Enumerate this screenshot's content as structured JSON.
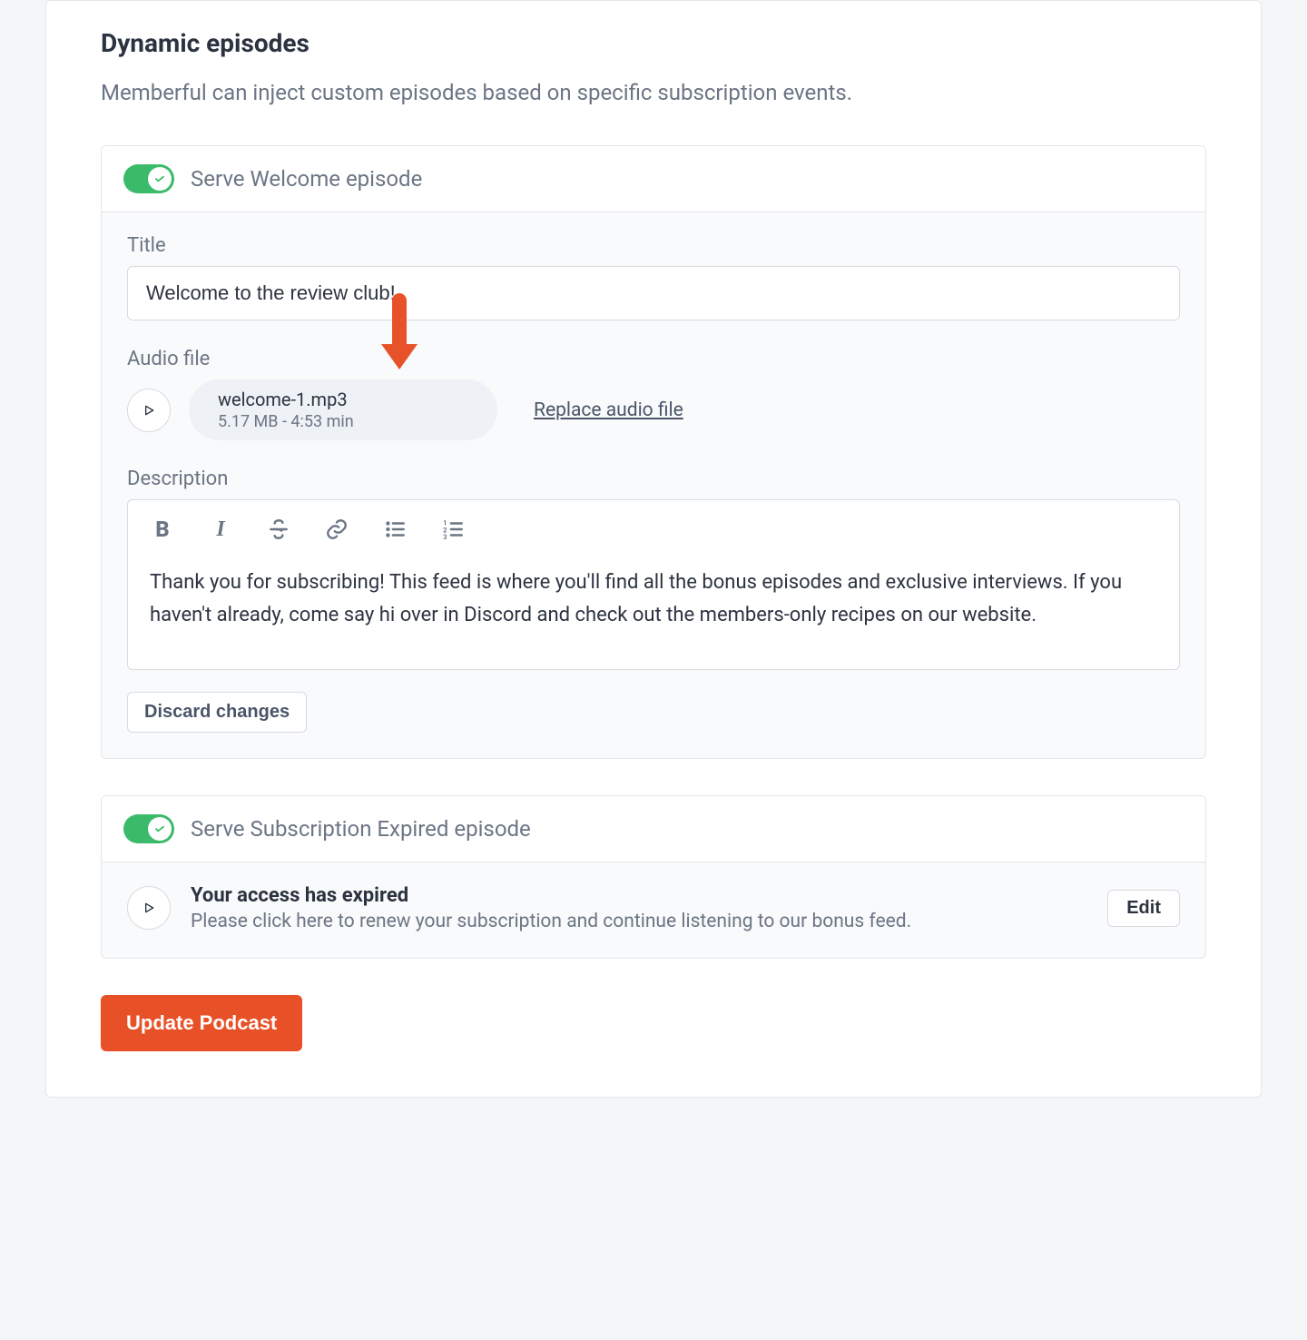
{
  "section": {
    "title": "Dynamic episodes",
    "subtitle": "Memberful can inject custom episodes based on specific subscription events."
  },
  "welcome_panel": {
    "toggle_label": "Serve Welcome episode",
    "title_label": "Title",
    "title_value": "Welcome to the review club!",
    "audio_label": "Audio file",
    "audio_filename": "welcome-1.mp3",
    "audio_meta": "5.17 MB - 4:53 min",
    "replace_label": "Replace audio file",
    "description_label": "Description",
    "description_text": "Thank you for subscribing! This feed is where you'll find all the bonus episodes and exclusive interviews. If you haven't already, come say hi over in Discord and check out the members-only recipes on our website.",
    "discard_label": "Discard changes"
  },
  "expired_panel": {
    "toggle_label": "Serve Subscription Expired episode",
    "title": "Your access has expired",
    "description": "Please click here to renew your subscription and continue listening to our bonus feed.",
    "edit_label": "Edit"
  },
  "actions": {
    "update_label": "Update Podcast"
  },
  "colors": {
    "accent_green": "#3bbb6a",
    "accent_orange": "#e85127",
    "arrow": "#e8522a"
  }
}
